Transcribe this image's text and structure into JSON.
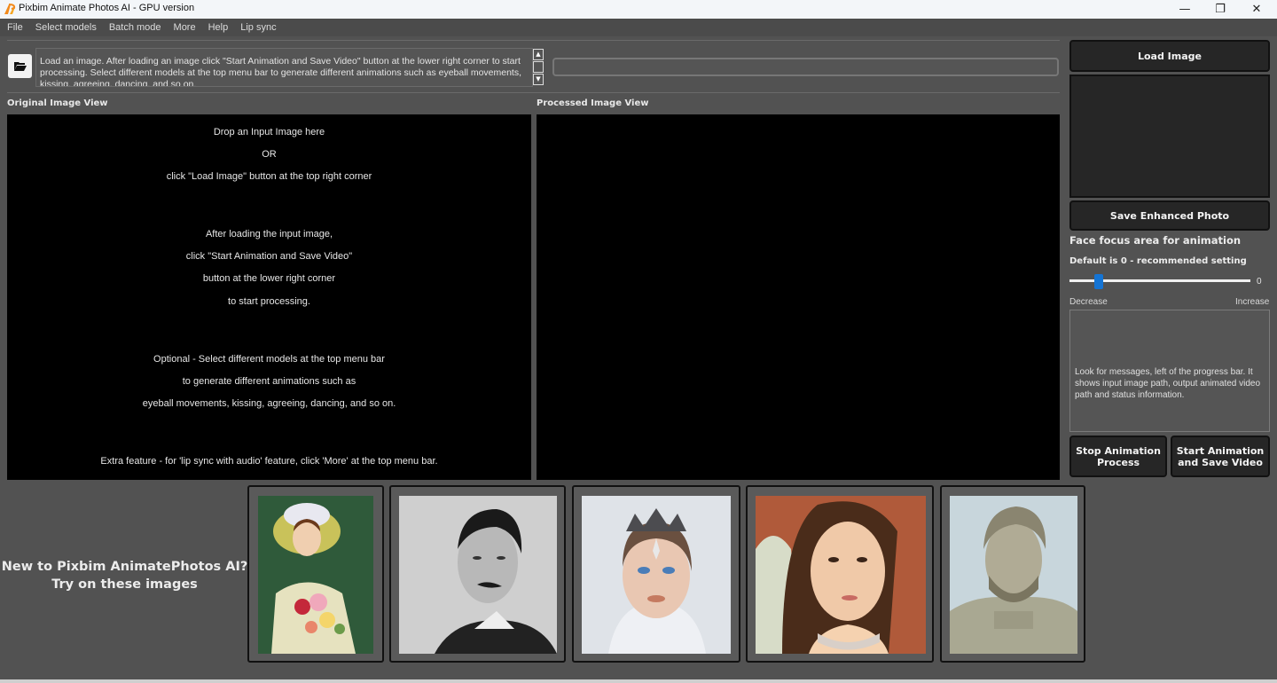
{
  "window": {
    "title": "Pixbim Animate Photos AI - GPU version",
    "controls": {
      "minimize": "—",
      "maximize": "❐",
      "close": "✕"
    }
  },
  "menu": [
    {
      "label": "File"
    },
    {
      "label": "Select models"
    },
    {
      "label": "Batch mode"
    },
    {
      "label": "More"
    },
    {
      "label": "Help"
    },
    {
      "label": "Lip sync"
    }
  ],
  "toolbar": {
    "open_icon": "folder-open-icon",
    "info_lines": [
      "Load an image. After loading an image click \"Start Animation and Save Video\" button at the lower right corner to start",
      "processing. Select different models at the top menu bar to generate different animations such as eyeball movements,",
      "kissing, agreeing, dancing, and so on."
    ],
    "scroll_up": "▲",
    "scroll_down": "▼",
    "progress_percent": 0
  },
  "views": {
    "original_label": "Original Image View",
    "processed_label": "Processed Image View",
    "drop_lines": [
      "Drop an Input Image here",
      "OR",
      "click \"Load Image\" button at the top right corner",
      "After loading the input image,",
      "click \"Start Animation and Save Video\"",
      "button at the lower right corner",
      "to start processing.",
      "Optional - Select different models at the top menu bar",
      "to generate different animations such as",
      "eyeball movements, kissing, agreeing, dancing, and so on.",
      "Extra feature - for 'lip sync with audio' feature, click 'More' at the top menu bar."
    ]
  },
  "right_panel": {
    "load_image": "Load Image",
    "save_enhanced": "Save Enhanced Photo",
    "face_focus_title": "Face focus area for animation",
    "default_note": "Default is 0 - recommended setting",
    "slider_value": "0",
    "slider_fraction": 0.16,
    "decrease": "Decrease",
    "increase": "Increase",
    "message": "Look for messages, left of the progress bar. It shows input image path, output animated video path and status information.",
    "stop_line1": "Stop Animation",
    "stop_line2": "Process",
    "start_line1": "Start Animation",
    "start_line2": "and Save Video"
  },
  "samples": {
    "prompt_line1": "New to Pixbim AnimatePhotos AI?",
    "prompt_line2": "Try on these images",
    "items": [
      {
        "name": "victorian-lady-with-bonnet"
      },
      {
        "name": "man-with-mustache-bw"
      },
      {
        "name": "woman-with-tiara"
      },
      {
        "name": "empress-portrait"
      },
      {
        "name": "marble-bust"
      }
    ]
  }
}
